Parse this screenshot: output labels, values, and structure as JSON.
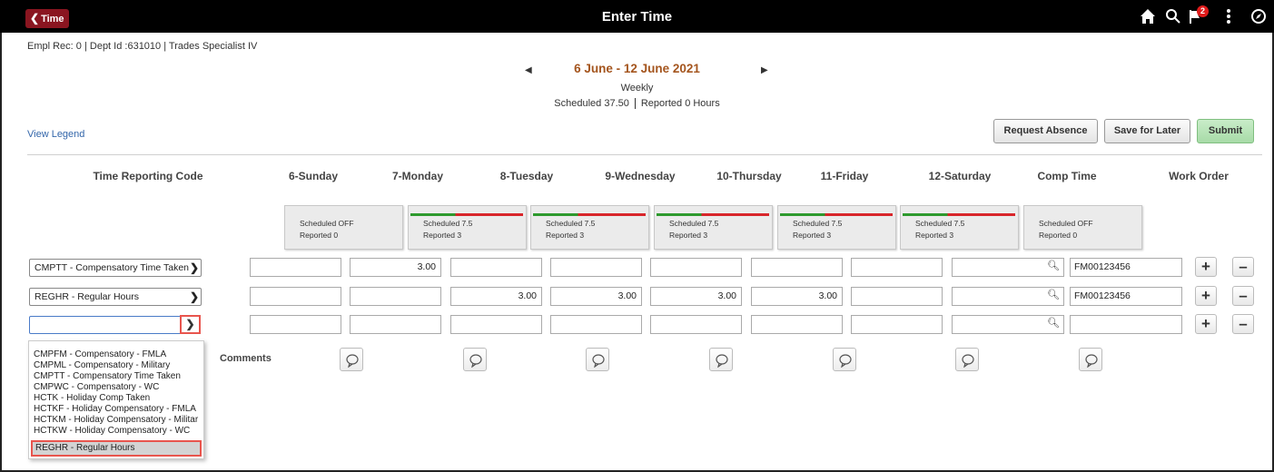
{
  "header": {
    "back_label": "Time",
    "title": "Enter Time",
    "notification_count": "2",
    "icons": [
      "home-icon",
      "search-icon",
      "flag-icon",
      "actions-menu-icon",
      "navbar-icon"
    ]
  },
  "employee_info": "Empl Rec: 0 | Dept Id :631010 | Trades Specialist IV",
  "period": {
    "date_range": "6 June - 12 June 2021",
    "type": "Weekly",
    "scheduled_label": "Scheduled",
    "scheduled_value": "37.50",
    "reported_label": "Reported",
    "reported_value": "0 Hours"
  },
  "links": {
    "view_legend": "View Legend"
  },
  "buttons": {
    "request_absence": "Request Absence",
    "save_for_later": "Save for Later",
    "submit": "Submit"
  },
  "columns": [
    "Time Reporting Code",
    "6-Sunday",
    "7-Monday",
    "8-Tuesday",
    "9-Wednesday",
    "10-Thursday",
    "11-Friday",
    "12-Saturday",
    "Comp Time",
    "Work Order"
  ],
  "day_cards": [
    {
      "scheduled": "Scheduled OFF",
      "reported": "Reported  0",
      "bar": false
    },
    {
      "scheduled": "Scheduled 7.5",
      "reported": "Reported  3",
      "bar": true
    },
    {
      "scheduled": "Scheduled 7.5",
      "reported": "Reported  3",
      "bar": true
    },
    {
      "scheduled": "Scheduled 7.5",
      "reported": "Reported  3",
      "bar": true
    },
    {
      "scheduled": "Scheduled 7.5",
      "reported": "Reported  3",
      "bar": true
    },
    {
      "scheduled": "Scheduled 7.5",
      "reported": "Reported  3",
      "bar": true
    },
    {
      "scheduled": "Scheduled OFF",
      "reported": "Reported  0",
      "bar": false
    }
  ],
  "rows": [
    {
      "trc": "CMPTT - Compensatory Time Taken",
      "hours": [
        "",
        "3.00",
        "",
        "",
        "",
        "",
        "",
        ""
      ],
      "work_order": "FM00123456"
    },
    {
      "trc": "REGHR - Regular Hours",
      "hours": [
        "",
        "",
        "3.00",
        "3.00",
        "3.00",
        "3.00",
        "",
        ""
      ],
      "work_order": "FM00123456"
    },
    {
      "trc": "",
      "hours": [
        "",
        "",
        "",
        "",
        "",
        "",
        "",
        ""
      ],
      "work_order": ""
    }
  ],
  "dropdown_options": [
    "CMPFM - Compensatory - FMLA",
    "CMPML - Compensatory - Military",
    "CMPTT - Compensatory Time Taken",
    "CMPWC - Compensatory - WC",
    "HCTK - Holiday Comp Taken",
    "HCTKF - Holiday Compensatory - FMLA",
    "HCTKM - Holiday Compensatory - Militar",
    "HCTKW - Holiday Compensatory - WC"
  ],
  "dropdown_selected": "REGHR - Regular Hours",
  "comments_label": "Comments",
  "colors": {
    "header_bg": "#000000",
    "back_button": "#8a1520",
    "date_range": "#a4551e",
    "bar_green": "#2e9a2e",
    "bar_red": "#d8262b",
    "highlight": "#e8554e"
  }
}
